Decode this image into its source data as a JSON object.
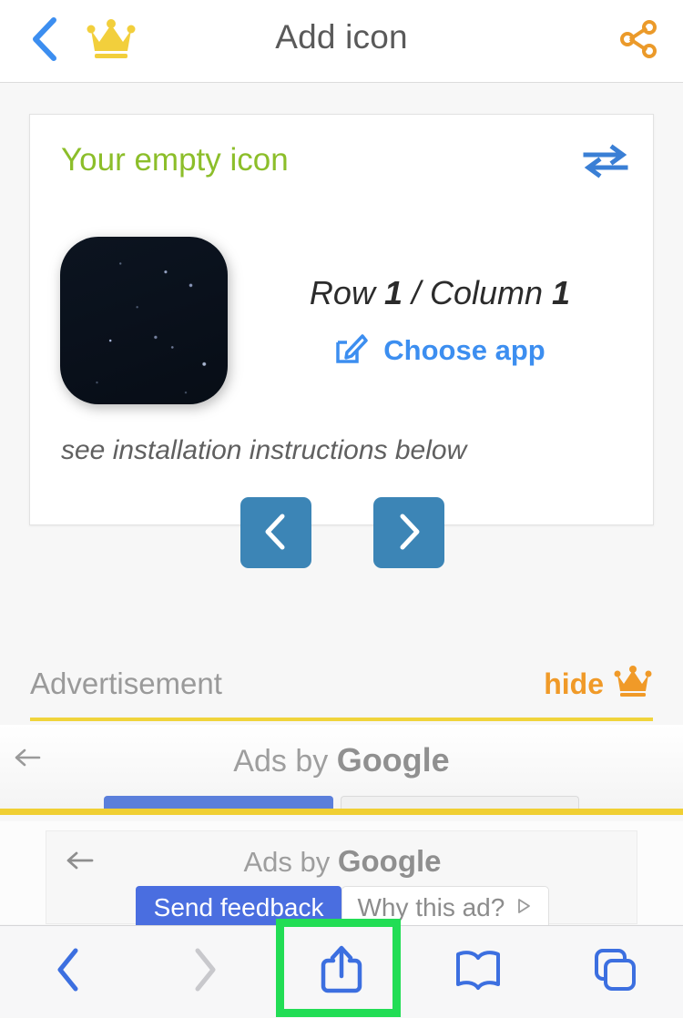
{
  "header": {
    "back_icon": "chevron-left-icon",
    "crown_icon": "crown-icon",
    "title": "Add icon",
    "share_icon": "share-network-icon"
  },
  "card": {
    "title": "Your empty icon",
    "swap_icon": "swap-arrows-icon",
    "thumbnail_alt": "empty-icon-preview",
    "position_prefix": "Row ",
    "position_row": "1",
    "position_separator": " / Column ",
    "position_column": "1",
    "choose_app_icon": "edit-pencil-icon",
    "choose_app_label": "Choose app",
    "install_note": "see installation instructions below",
    "prev_icon": "chevron-left-icon",
    "next_icon": "chevron-right-icon"
  },
  "advertisement": {
    "label": "Advertisement",
    "hide_label": "hide",
    "hide_crown_icon": "crown-icon",
    "slot": {
      "back_icon": "arrow-left-icon",
      "byline_prefix": "Ads by ",
      "byline_brand": "Google"
    }
  },
  "ad_overlay": {
    "back_icon": "arrow-left-icon",
    "byline_prefix": "Ads by ",
    "byline_brand": "Google",
    "send_feedback_label": "Send feedback",
    "why_this_ad_label": "Why this ad?",
    "why_this_ad_icon": "triangle-play-icon"
  },
  "browser_toolbar": {
    "items": [
      {
        "name": "back-button",
        "icon": "chevron-left-icon",
        "enabled": true
      },
      {
        "name": "forward-button",
        "icon": "chevron-right-icon",
        "enabled": false
      },
      {
        "name": "share-button",
        "icon": "share-upload-icon",
        "enabled": true,
        "highlighted": true
      },
      {
        "name": "bookmarks-button",
        "icon": "book-icon",
        "enabled": true
      },
      {
        "name": "tabs-button",
        "icon": "tabs-icon",
        "enabled": true
      }
    ]
  },
  "colors": {
    "brand_green": "#8cbe2a",
    "link_blue": "#3c8ef0",
    "nav_button_blue": "#3c85b6",
    "crown_yellow": "#f2cf3c",
    "share_orange": "#eb9a2a",
    "hide_orange": "#f09a28",
    "ad_rule_yellow": "#f0d43c",
    "highlight_green": "#22dd55",
    "toolbar_blue": "#3c6fe0"
  }
}
